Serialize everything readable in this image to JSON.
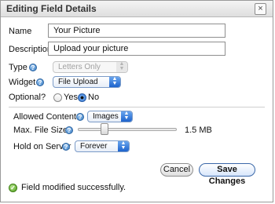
{
  "dialog": {
    "title": "Editing Field Details",
    "close_glyph": "×"
  },
  "form": {
    "name_label": "Name",
    "name_value": "Your Picture",
    "description_label": "Description",
    "description_value": "Upload your picture",
    "type_label": "Type",
    "type_value": "Letters Only",
    "widget_label": "Widget",
    "widget_value": "File Upload",
    "optional_label": "Optional?",
    "optional_yes": "Yes",
    "optional_no": "No",
    "optional_selected": "No",
    "allowed_content_label": "Allowed Content",
    "allowed_content_value": "Images",
    "max_file_size_label": "Max. File Size",
    "max_file_size_value": "1.5 MB",
    "max_file_size_fraction": 0.25,
    "hold_label": "Hold on Server",
    "hold_value": "Forever"
  },
  "buttons": {
    "cancel": "Cancel",
    "save": "Save Changes"
  },
  "status": {
    "message": "Field modified successfully."
  },
  "icons": {
    "help": "help-icon",
    "close": "close-icon",
    "success": "check-icon",
    "dropdown": "chevron-updown-icon"
  },
  "colors": {
    "accent": "#2d6fd0",
    "success": "#4f9e1d"
  }
}
